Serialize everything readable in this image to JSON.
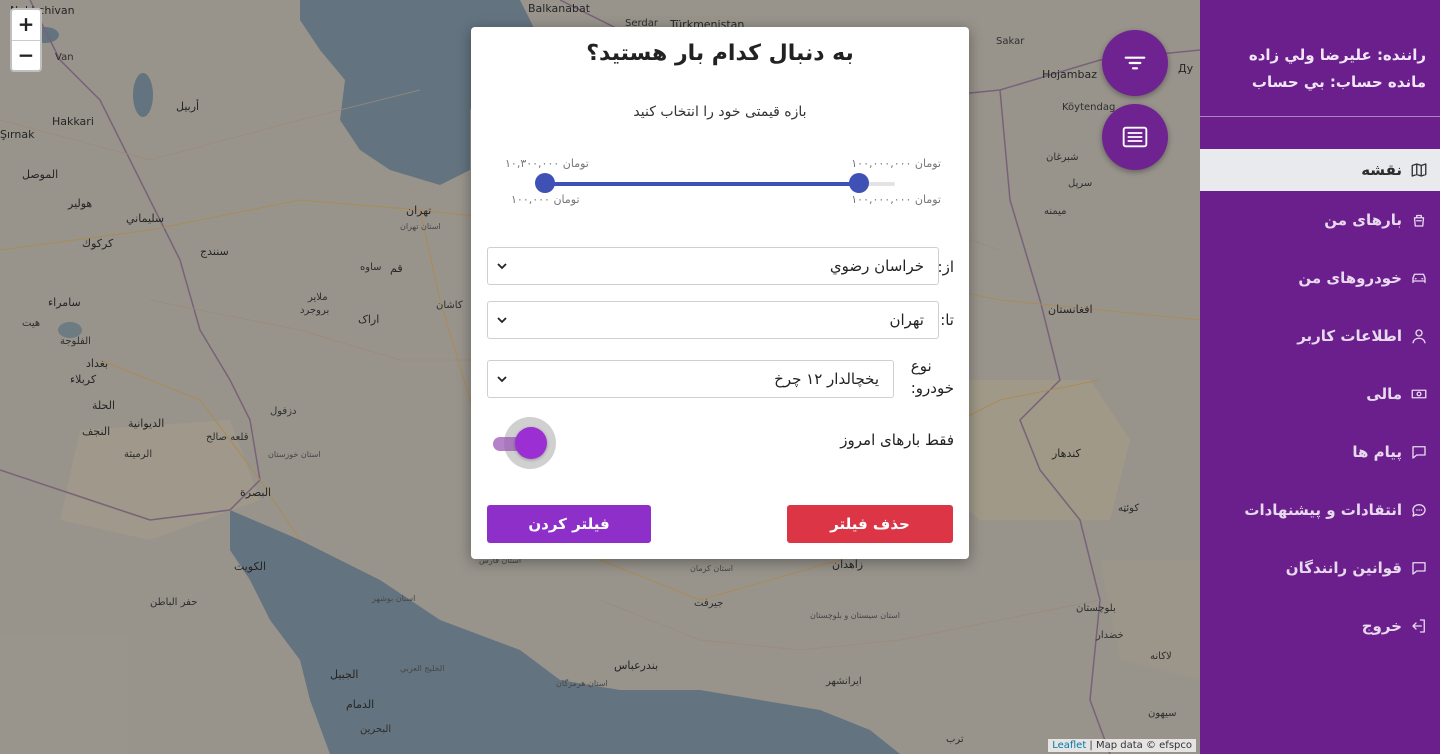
{
  "map": {
    "labels": [
      {
        "t": "Nakhchivan",
        "c": "big"
      },
      {
        "t": "Van",
        "c": ""
      },
      {
        "t": "Hakkari",
        "c": "big"
      },
      {
        "t": "Şırnak",
        "c": "big"
      },
      {
        "t": "الموصل",
        "c": "big"
      },
      {
        "t": "أربيل",
        "c": "big"
      },
      {
        "t": "هولير",
        "c": "big"
      },
      {
        "t": "سليماني",
        "c": "big"
      },
      {
        "t": "كركوك",
        "c": "big"
      },
      {
        "t": "سنندج",
        "c": "big"
      },
      {
        "t": "سامراء",
        "c": "big"
      },
      {
        "t": "هيت",
        "c": ""
      },
      {
        "t": "بغداد",
        "c": "big"
      },
      {
        "t": "الفلوجة",
        "c": ""
      },
      {
        "t": "كربلاء",
        "c": "big"
      },
      {
        "t": "الحلة",
        "c": "big"
      },
      {
        "t": "النجف",
        "c": "big"
      },
      {
        "t": "الديوانية",
        "c": "big"
      },
      {
        "t": "الرميثة",
        "c": ""
      },
      {
        "t": "البصرة",
        "c": "big"
      },
      {
        "t": "الكويت",
        "c": "big"
      },
      {
        "t": "حفر الباطن",
        "c": ""
      },
      {
        "t": "الجبيل",
        "c": "big"
      },
      {
        "t": "الدمام",
        "c": "big"
      },
      {
        "t": "البحرين",
        "c": ""
      },
      {
        "t": "Balkanabat",
        "c": "big"
      },
      {
        "t": "Serdar",
        "c": ""
      },
      {
        "t": "Türkmenistan",
        "c": "big"
      },
      {
        "t": "Sakar",
        "c": ""
      },
      {
        "t": "Hojambaz",
        "c": "big"
      },
      {
        "t": "Köytendag",
        "c": ""
      },
      {
        "t": "تهران",
        "c": "big"
      },
      {
        "t": "قم",
        "c": "big"
      },
      {
        "t": "ساوه",
        "c": ""
      },
      {
        "t": "اراک",
        "c": "big"
      },
      {
        "t": "کاشان",
        "c": ""
      },
      {
        "t": "بروجرد",
        "c": ""
      },
      {
        "t": "ملایر",
        "c": ""
      },
      {
        "t": "دزفول",
        "c": ""
      },
      {
        "t": "قلعه صالح",
        "c": ""
      },
      {
        "t": "زاهدان",
        "c": "big"
      },
      {
        "t": "جيرفت",
        "c": ""
      },
      {
        "t": "بندرعباس",
        "c": "big"
      },
      {
        "t": "ايرانشهر",
        "c": ""
      },
      {
        "t": "شبرغان",
        "c": ""
      },
      {
        "t": "سرپل",
        "c": ""
      },
      {
        "t": "ميمنه",
        "c": ""
      },
      {
        "t": "افغانستان",
        "c": "big"
      },
      {
        "t": "کندهار",
        "c": "big"
      },
      {
        "t": "کوئټه",
        "c": ""
      },
      {
        "t": "بلوچستان",
        "c": ""
      },
      {
        "t": "خضدار",
        "c": ""
      },
      {
        "t": "لاکانه",
        "c": ""
      },
      {
        "t": "سيهون",
        "c": ""
      },
      {
        "t": "ترب",
        "c": ""
      },
      {
        "t": "استان تهران",
        "c": "prov"
      },
      {
        "t": "استان اصفهان",
        "c": "prov"
      },
      {
        "t": "استان خوزستان",
        "c": "prov"
      },
      {
        "t": "استان کرمان",
        "c": "prov"
      },
      {
        "t": "استان فارس",
        "c": "prov"
      },
      {
        "t": "استان بوشهر",
        "c": "prov"
      },
      {
        "t": "استان هرمزگان",
        "c": "prov"
      },
      {
        "t": "الخليج العربي",
        "c": "prov"
      },
      {
        "t": "استان سيستان و بلوچستان",
        "c": "prov"
      },
      {
        "t": "Ду",
        "c": "big"
      }
    ],
    "zoom_in": "+",
    "zoom_out": "−",
    "attribution_link": "Leaflet",
    "attribution_text": " | Map data © efspco"
  },
  "fabs": {
    "filter_icon": "filter-lines-icon",
    "list_icon": "list-icon"
  },
  "sidebar": {
    "driver": "راننده: عليرضا ولي زاده",
    "balance": "مانده حساب: بي حساب",
    "items": [
      {
        "label": "نقشه",
        "icon": "map-icon",
        "active": true
      },
      {
        "label": "بارهای من",
        "icon": "cargo-icon"
      },
      {
        "label": "خودروهای من",
        "icon": "car-icon"
      },
      {
        "label": "اطلاعات کاربر",
        "icon": "user-icon"
      },
      {
        "label": "مالی",
        "icon": "money-icon"
      },
      {
        "label": "پیام ها",
        "icon": "message-icon"
      },
      {
        "label": "انتقادات و پیشنهادات",
        "icon": "feedback-icon"
      },
      {
        "label": "قوانین رانندگان",
        "icon": "rules-icon"
      },
      {
        "label": "خروج",
        "icon": "logout-icon"
      }
    ]
  },
  "modal": {
    "title": "به دنبال کدام بار هستید؟",
    "subtitle": "بازه قیمتی خود را انتخاب کنید",
    "price": {
      "min": 100000,
      "max": 100000000,
      "selected_low": 10300000,
      "selected_high": 100000000,
      "low_label": "۱۰,۳۰۰,۰۰۰ تومان",
      "high_label": "۱۰۰,۰۰۰,۰۰۰ تومان",
      "min_label": "۱۰۰,۰۰۰ تومان",
      "max_label": "۱۰۰,۰۰۰,۰۰۰ تومان"
    },
    "from_label": "از:",
    "from_value": "خراسان رضوي",
    "to_label": "تا:",
    "to_value": "تهران",
    "vehicle_label_1": "نوع",
    "vehicle_label_2": "خودرو:",
    "vehicle_value": "يخچالدار ۱۲ چرخ",
    "today_only_label": "فقط بارهای امروز",
    "today_only": true,
    "clear_button": "حذف فیلتر",
    "apply_button": "فیلتر کردن"
  },
  "colors": {
    "sidebar": "#6b1f8c",
    "accent": "#8e2fc9",
    "danger": "#dc3545",
    "slider": "#3f51b5"
  }
}
